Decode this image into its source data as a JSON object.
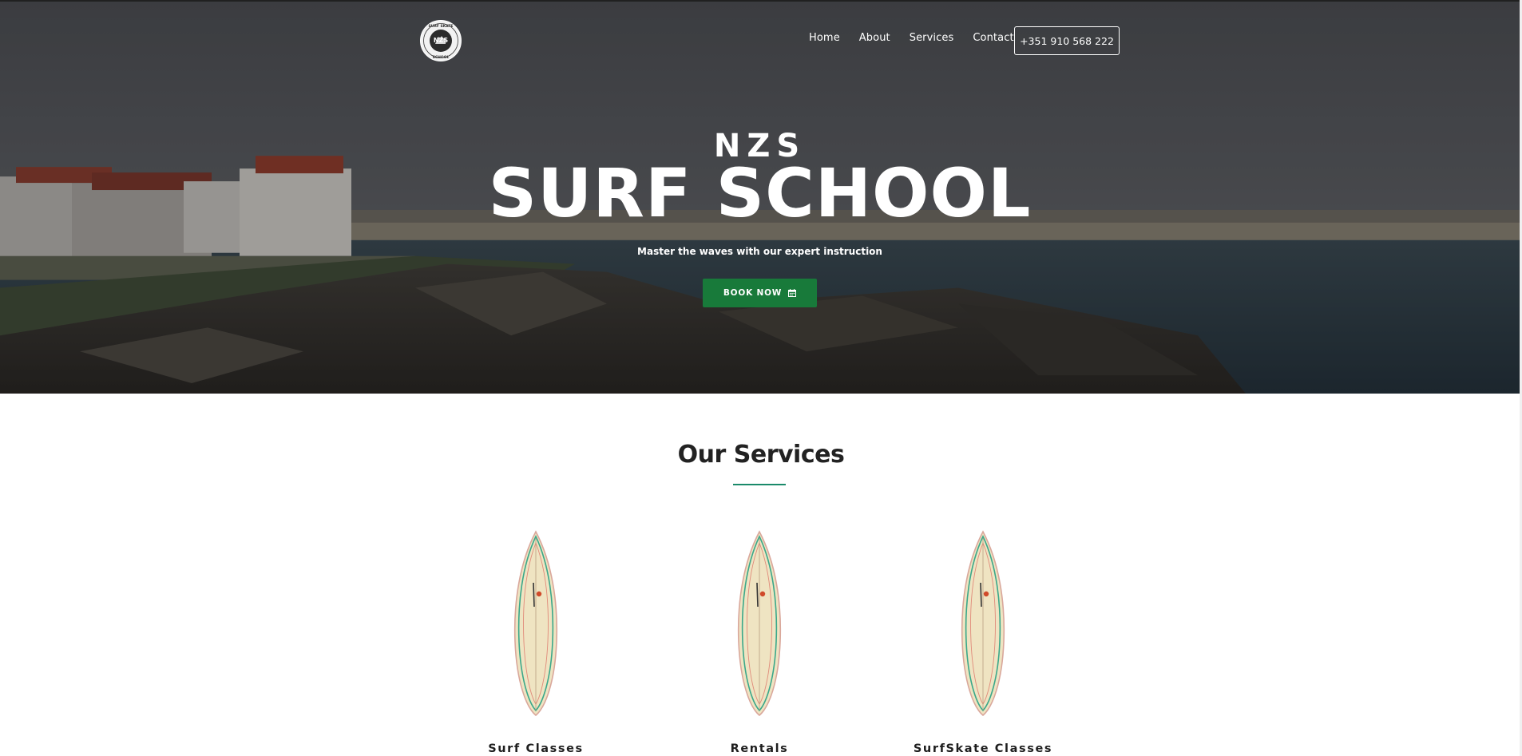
{
  "nav": {
    "links": [
      "Home",
      "About",
      "Services",
      "Contact"
    ],
    "phone": "+351 910 568 222"
  },
  "logo": {
    "text_top": "SURF SKATE",
    "text_center": "NZS",
    "text_bottom": "SCHOOL",
    "icon": "shaka-hand-icon"
  },
  "hero": {
    "kicker": "NZS",
    "title": "SURF SCHOOL",
    "subtitle": "Master the waves with our expert instruction",
    "cta_label": "BOOK NOW",
    "cta_icon": "calendar-icon"
  },
  "services": {
    "title": "Our Services",
    "items": [
      {
        "label": "Surf Classes",
        "icon": "surfboard-icon"
      },
      {
        "label": "Rentals",
        "icon": "surfboard-icon"
      },
      {
        "label": "SurfSkate Classes",
        "icon": "surfboard-icon"
      }
    ]
  },
  "colors": {
    "accent_green": "#187a3a",
    "rule_teal": "#1a8a6a",
    "text_dark": "#222222"
  }
}
